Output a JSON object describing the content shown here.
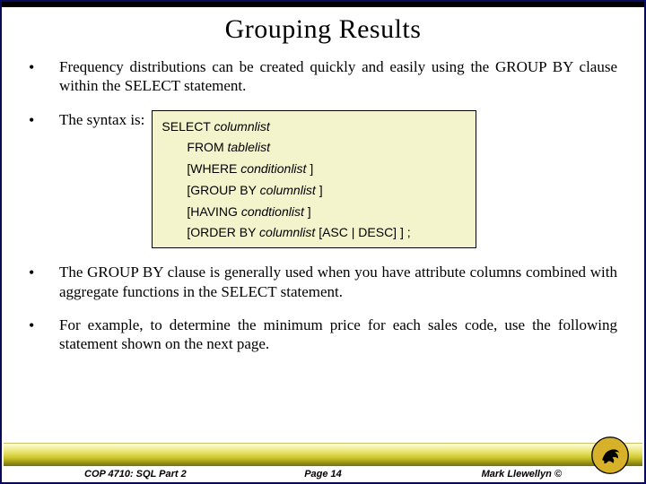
{
  "title": "Grouping Results",
  "bullets": {
    "b1": "Frequency distributions can be created quickly and easily using the GROUP BY clause within the SELECT statement.",
    "b2_lead": "The syntax is:",
    "b3": "The GROUP BY clause is generally used when you have attribute columns combined with aggregate functions in the SELECT statement.",
    "b4": "For example, to determine the minimum price for each sales code, use the following statement shown on the next page."
  },
  "syntax": {
    "l1_kw": "SELECT  ",
    "l1_it": "columnlist",
    "l2_kw": "FROM ",
    "l2_it": "tablelist",
    "l3_a": "[WHERE ",
    "l3_it": "conditionlist",
    "l3_b": " ]",
    "l4_a": "[GROUP BY ",
    "l4_it": "columnlist",
    "l4_b": " ]",
    "l5_a": "[HAVING ",
    "l5_it": "condtionlist",
    "l5_b": " ]",
    "l6_a": "[ORDER BY ",
    "l6_it": "columnlist ",
    "l6_b": " [ASC | DESC] ] ;"
  },
  "footer": {
    "left": "COP 4710: SQL Part 2",
    "center": "Page 14",
    "right": "Mark Llewellyn ©"
  }
}
